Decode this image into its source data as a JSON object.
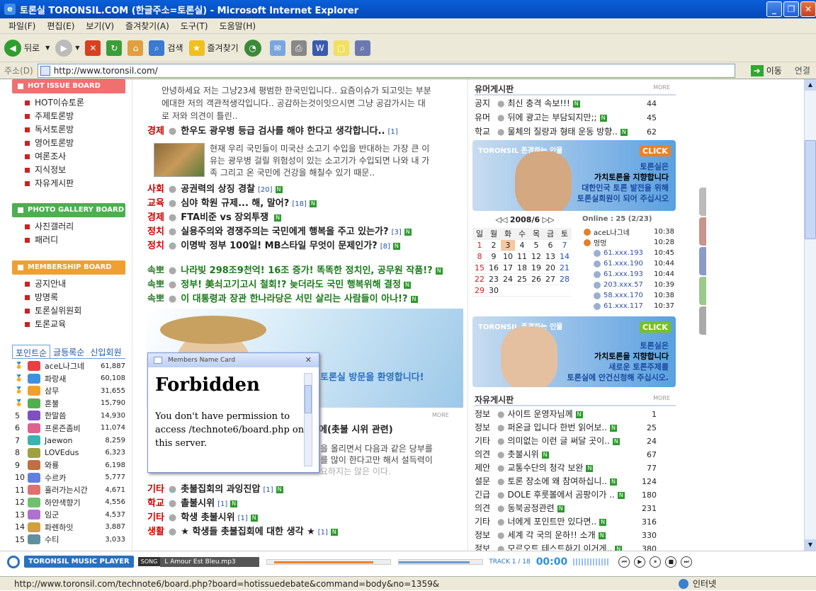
{
  "window": {
    "title": "토론실 TORONSIL.COM (한글주소=토론실) - Microsoft Internet Explorer"
  },
  "menu": [
    "파일(F)",
    "편집(E)",
    "보기(V)",
    "즐겨찾기(A)",
    "도구(T)",
    "도움말(H)"
  ],
  "toolbar": {
    "back": "뒤로",
    "search": "검색",
    "favorites": "즐겨찾기"
  },
  "address": {
    "label": "주소(D)",
    "url": "http://www.toronsil.com/",
    "go": "이동",
    "links": "연결"
  },
  "left": {
    "hot": {
      "title": "HOT ISSUE BOARD",
      "color": "#f07070",
      "items": [
        "HOT이슈토론",
        "주제토론방",
        "독서토론방",
        "영어토론방",
        "여론조사",
        "지식정보",
        "자유게시판"
      ]
    },
    "photo": {
      "title": "PHOTO GALLERY BOARD",
      "color": "#4caf50",
      "items": [
        "사진갤러리",
        "패러디"
      ]
    },
    "member": {
      "title": "MEMBERSHIP BOARD",
      "color": "#f0a030",
      "items": [
        "공지안내",
        "방명록",
        "토론실위원회",
        "토론교육"
      ]
    },
    "tabs": [
      "포인트순",
      "글등록순",
      "신입회원"
    ],
    "ranks": [
      {
        "n": "",
        "name": "aceL나그네",
        "score": "61,887"
      },
      {
        "n": "",
        "name": "파랑새",
        "score": "60,108"
      },
      {
        "n": "",
        "name": "삼무",
        "score": "31,655"
      },
      {
        "n": "",
        "name": "혼불",
        "score": "15,790"
      },
      {
        "n": "5",
        "name": "한말씀",
        "score": "14,930"
      },
      {
        "n": "6",
        "name": "프론즌좀비",
        "score": "11,074"
      },
      {
        "n": "7",
        "name": "Jaewon",
        "score": "8,259"
      },
      {
        "n": "8",
        "name": "LOVEdus",
        "score": "6,323"
      },
      {
        "n": "9",
        "name": "와룡",
        "score": "6,198"
      },
      {
        "n": "10",
        "name": "수르카",
        "score": "5,777"
      },
      {
        "n": "11",
        "name": "흘러가는시간",
        "score": "4,671"
      },
      {
        "n": "12",
        "name": "하얀색향기",
        "score": "4,556"
      },
      {
        "n": "13",
        "name": "임군",
        "score": "4,537"
      },
      {
        "n": "14",
        "name": "파렌하잇",
        "score": "3,887"
      },
      {
        "n": "15",
        "name": "수티",
        "score": "3,033"
      }
    ]
  },
  "middle": {
    "intro": [
      "안녕하세요 저는 그냥23세 평범한 한국민입니다.. 요즘이슈가 되고잇는 부분",
      "에대한 저의 객관적생각입니다.. 공감하는것이잇으시면 그냥 공감가시는 대",
      "로 저와 의견이 틀린.."
    ],
    "headline": {
      "cat": "경제",
      "title": "한우도 광우병 등급 검사를 해야 한다고 생각합니다..",
      "count": "[1]"
    },
    "summary": [
      "현재 우리 국민들이 미국산 소고기 수입을 반대하는 가장 큰 이",
      "유는 광우병 걸릴 위험성이 있는 소고기가 수입되면 나와 내 가",
      "족 그리고 온 국민에 건강을 해칠수 있기 때문.."
    ],
    "posts": [
      {
        "cat": "사회",
        "title": "공권력의 상징 경찰",
        "count": "[20]"
      },
      {
        "cat": "교육",
        "title": "심야 학원 규제... 해, 말어?",
        "count": "[18]"
      },
      {
        "cat": "경제",
        "title": "FTA비준 vs 장외투쟁",
        "count": ""
      },
      {
        "cat": "정치",
        "title": "실용주의와 경쟁주의는 국민에게 행복을 주고 있는가?",
        "count": "[3]"
      },
      {
        "cat": "정치",
        "title": "이명박 정부 100일! MB스타일 무엇이 문제인가?",
        "count": "[8]"
      }
    ],
    "breaking": [
      {
        "cat": "속뽀",
        "title": "나라빚 298조9천억! 16조 증가! 똑똑한 정치인, 공무원 작품!?"
      },
      {
        "cat": "속뽀",
        "title": "정부! 美쇠고기고시 철회!? 늦더라도 국민 행복위해 결정"
      },
      {
        "cat": "속뽀",
        "title": "이 대통령과 장관 한나라당은 서민 살리는 사람들이 아나!?"
      }
    ],
    "welcome": "토론실 방문을 환영합니다!",
    "more": "MORE",
    "hidden_post": "에(촛불 시위 관련)",
    "hidden_text": [
      "을 올리면서 다음과 같은 당부를",
      "를 많이 한다고만 해서 설득력이",
      "요하지는 않은 이다."
    ],
    "posts2": [
      {
        "cat": "기타",
        "title": "촛불집회의 과잉진압",
        "count": "[1]"
      },
      {
        "cat": "학교",
        "title": "촐불시위",
        "count": "[1]"
      },
      {
        "cat": "기타",
        "title": "학생 촛불시위",
        "count": "[1]"
      },
      {
        "cat": "생활",
        "title": "★ 학생들 촛불집회에 대한 생각 ★",
        "count": "[1]"
      }
    ]
  },
  "popup": {
    "title": "Members Name Card",
    "heading": "Forbidden",
    "message": "You don't have permission to access /technote6/board.php on this server."
  },
  "right": {
    "humor": {
      "title": "유머게시판",
      "more": "MORE",
      "items": [
        {
          "cat": "공지",
          "title": "최신 충격 속보!!!",
          "count": "44"
        },
        {
          "cat": "유머",
          "title": "뒤에 광고는 부담되지만;;",
          "count": "45"
        },
        {
          "cat": "학교",
          "title": "물체의 질량과 형태 운동 방향..",
          "count": "62"
        }
      ]
    },
    "banner1": {
      "tag": "TORONSIL 존경하는 인물",
      "click": "CLICK",
      "l1": "토론실은",
      "l2": "가치토론을 지향합니다",
      "l3": "대한민국 토론 발전을 위해",
      "l4": "토론실회원이 되어 주십시오"
    },
    "calendar": {
      "title": "2008/6",
      "days": [
        "일",
        "월",
        "화",
        "수",
        "목",
        "금",
        "토"
      ],
      "weeks": [
        [
          "1",
          "2",
          "3",
          "4",
          "5",
          "6",
          "7"
        ],
        [
          "8",
          "9",
          "10",
          "11",
          "12",
          "13",
          "14"
        ],
        [
          "15",
          "16",
          "17",
          "18",
          "19",
          "20",
          "21"
        ],
        [
          "22",
          "23",
          "24",
          "25",
          "26",
          "27",
          "28"
        ],
        [
          "29",
          "30",
          "",
          "",
          "",
          "",
          ""
        ]
      ],
      "today": "3"
    },
    "online": {
      "title": "Online : 25 (2/23)",
      "users": [
        {
          "name": "aceL나그네",
          "time": "10:38"
        },
        {
          "name": "멍멍",
          "time": "10:28"
        },
        {
          "name": "61.xxx.193",
          "time": "10:45"
        },
        {
          "name": "61.xxx.190",
          "time": "10:44"
        },
        {
          "name": "61.xxx.193",
          "time": "10:44"
        },
        {
          "name": "203.xxx.57",
          "time": "10:39"
        },
        {
          "name": "58.xxx.170",
          "time": "10:38"
        },
        {
          "name": "61.xxx.117",
          "time": "10:37"
        }
      ]
    },
    "banner2": {
      "tag": "TORONSIL 존경하는 인물",
      "click": "CLICK",
      "l1": "토론실은",
      "l2": "가치토론을 지향합니다",
      "l3": "새로운 토론주제를",
      "l4": "토론실에 안건신청해 주십시오."
    },
    "free": {
      "title": "자유게시판",
      "more": "MORE",
      "items": [
        {
          "cat": "정보",
          "title": "사이트 운영자님께",
          "count": "1"
        },
        {
          "cat": "정보",
          "title": "퍼온글 입니다 한번 읽어보..",
          "count": "25"
        },
        {
          "cat": "기타",
          "title": "의미없는 이런 글 써달 곳이..",
          "count": "24"
        },
        {
          "cat": "의견",
          "title": "촛불시위",
          "count": "67"
        },
        {
          "cat": "제안",
          "title": "교통수단의 청각 보완",
          "count": "77"
        },
        {
          "cat": "설문",
          "title": "토론 장소에 왜 참여하십니..",
          "count": "124"
        },
        {
          "cat": "긴급",
          "title": "DOLE 후룻볼에서 곰팡이가 ..",
          "count": "180"
        },
        {
          "cat": "의견",
          "title": "동북공정관련",
          "count": "231"
        },
        {
          "cat": "기타",
          "title": "너에게 포인트만 있다면..",
          "count": "316"
        },
        {
          "cat": "정보",
          "title": "세계 각 국의 운하!! 소개",
          "count": "330"
        },
        {
          "cat": "정보",
          "title": "모르오트 테스트하기 이거게..",
          "count": "380"
        }
      ]
    }
  },
  "music": {
    "title": "TORONSIL MUSIC PLAYER",
    "song_label": "SONG",
    "song": "L Amour Est Bleu.mp3",
    "track": "TRACK 1 / 18",
    "time": "00:00"
  },
  "status": {
    "url": "http://www.toronsil.com/technote6/board.php?board=hotissuedebate&command=body&no=1359&",
    "zone": "인터넷"
  }
}
